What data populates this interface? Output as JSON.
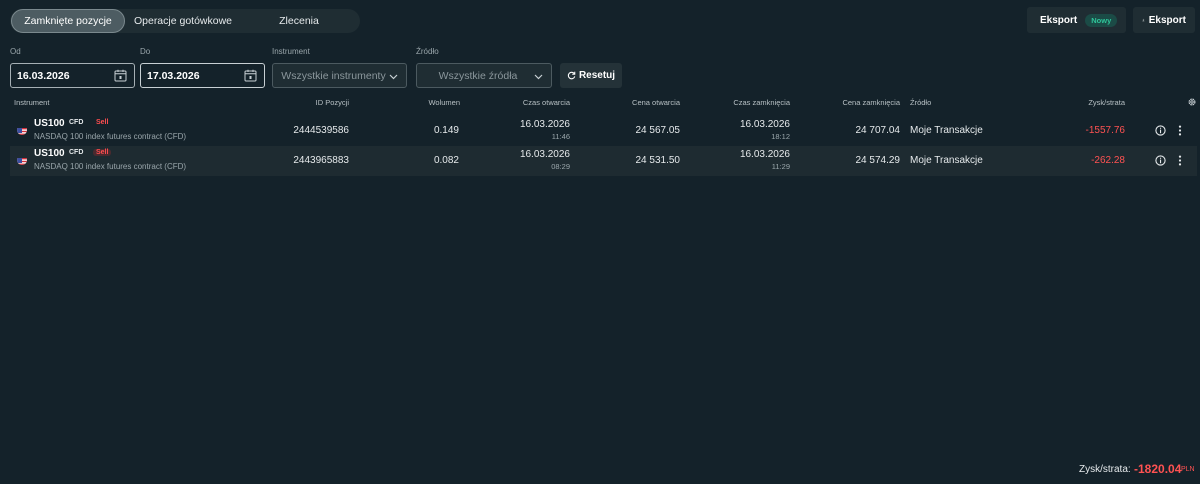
{
  "tabs": [
    {
      "label": "Zamknięte pozycje",
      "active": true
    },
    {
      "label": "Operacje gotówkowe",
      "active": false
    },
    {
      "label": "Zlecenia",
      "active": false
    }
  ],
  "toolbar": {
    "export1_label": "Eksport",
    "export1_badge": "Nowy",
    "export2_label": "Eksport"
  },
  "filters": {
    "from_label": "Od",
    "from_value": "16.03.2026",
    "to_label": "Do",
    "to_value": "17.03.2026",
    "instrument_label": "Instrument",
    "instrument_value": "Wszystkie instrumenty",
    "source_label": "Źródło",
    "source_value": "Wszystkie źródła",
    "reset_label": "Resetuj"
  },
  "table": {
    "headers": {
      "instrument": "Instrument",
      "position_id": "ID Pozycji",
      "volume": "Wolumen",
      "open_time": "Czas otwarcia",
      "open_price": "Cena otwarcia",
      "close_time": "Czas zamknięcia",
      "close_price": "Cena zamknięcia",
      "source": "Źródło",
      "pnl": "Zysk/strata"
    },
    "rows": [
      {
        "symbol": "US100",
        "type": "CFD",
        "side": "Sell",
        "description": "NASDAQ 100 index futures contract (CFD)",
        "position_id": "2444539586",
        "volume": "0.149",
        "open_date": "16.03.2026",
        "open_time": "11:46",
        "open_price": "24 567.05",
        "close_date": "16.03.2026",
        "close_time": "18:12",
        "close_price": "24 707.04",
        "source": "Moje Transakcje",
        "pnl": "-1557.76"
      },
      {
        "symbol": "US100",
        "type": "CFD",
        "side": "Sell",
        "description": "NASDAQ 100 index futures contract (CFD)",
        "position_id": "2443965883",
        "volume": "0.082",
        "open_date": "16.03.2026",
        "open_time": "08:29",
        "open_price": "24 531.50",
        "close_date": "16.03.2026",
        "close_time": "11:29",
        "close_price": "24 574.29",
        "source": "Moje Transakcje",
        "pnl": "-262.28"
      }
    ]
  },
  "footer": {
    "label": "Zysk/strata:",
    "value": "-1820.04",
    "currency": "PLN"
  },
  "colors": {
    "background": "#14222a",
    "loss": "#ff5252",
    "sell": "#ff4d4f",
    "badge_green": "#2fc59a"
  },
  "icons": [
    "download-icon",
    "calendar-icon",
    "chevron-down-icon",
    "refresh-icon",
    "gear-icon",
    "us-flag-icon",
    "info-icon",
    "more-vertical-icon"
  ]
}
